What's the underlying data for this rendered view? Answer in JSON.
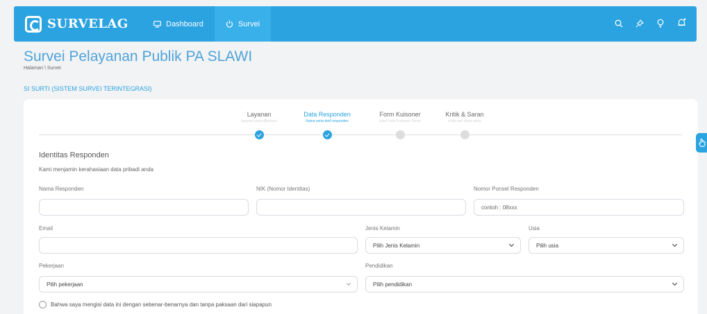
{
  "app": {
    "brand": "SURVELAG"
  },
  "nav": {
    "items": [
      {
        "label": "Dashboard",
        "icon": "monitor-icon"
      },
      {
        "label": "Survei",
        "icon": "power-icon"
      }
    ],
    "right_icons": [
      "search-icon",
      "pin-icon",
      "lightbulb-icon",
      "bell-icon"
    ]
  },
  "page": {
    "title": "Survei Pelayanan Publik PA SLAWI",
    "breadcrumb": "Halaman \\ Survei",
    "section": "SI SURTI (SISTEM SURVEI TERINTEGRASI)"
  },
  "steps": [
    {
      "title": "Layanan",
      "sub": "layanan yang diberikan",
      "done": true
    },
    {
      "title": "Data Responden",
      "sub": "Nama serta detil responden",
      "done": true,
      "current": true
    },
    {
      "title": "Form Kuisoner",
      "sub": "Isian Form Kuisoner Survei",
      "done": false
    },
    {
      "title": "Kritik & Saran",
      "sub": "Kritik dan saran anda",
      "done": false
    }
  ],
  "form": {
    "heading": "Identitas Responden",
    "subheading": "Kami menjamin kerahasiaan data pribadi anda",
    "nama_label": "Nama Responden",
    "nama_value": "",
    "nik_label": "NIK (Nomor Identitas)",
    "nik_value": "",
    "ponsel_label": "Nomor Ponsel Responden",
    "ponsel_placeholder": "contoh : 08xxx",
    "email_label": "Email",
    "email_value": "",
    "gender_label": "Jenis Kelamin",
    "gender_value": "Pilih Jenis Kelamin",
    "usia_label": "Usia",
    "usia_value": "Pilih usia",
    "pekerjaan_label": "Pekerjaan",
    "pekerjaan_value": "Pilih pekerjaan",
    "pendidikan_label": "Pendidikan",
    "pendidikan_value": "Pilih pendidikan",
    "agreement": "Bahwa saya mengisi data ini dengan sebenar-benarnya dan tanpa paksaan dari siapapun"
  },
  "colors": {
    "primary": "#2ba3e0",
    "title": "#4fa3d9",
    "background": "#f2f3f5"
  }
}
